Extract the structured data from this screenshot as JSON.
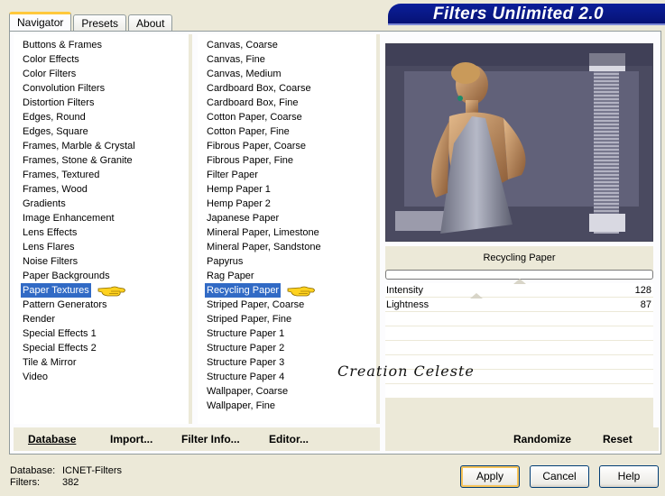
{
  "app": {
    "title": "Filters Unlimited 2.0"
  },
  "tabs": [
    {
      "label": "Navigator",
      "active": true
    },
    {
      "label": "Presets",
      "active": false
    },
    {
      "label": "About",
      "active": false
    }
  ],
  "categories": {
    "items": [
      "Buttons & Frames",
      "Color Effects",
      "Color Filters",
      "Convolution Filters",
      "Distortion Filters",
      "Edges, Round",
      "Edges, Square",
      "Frames, Marble & Crystal",
      "Frames, Stone & Granite",
      "Frames, Textured",
      "Frames, Wood",
      "Gradients",
      "Image Enhancement",
      "Lens Effects",
      "Lens Flares",
      "Noise Filters",
      "Paper Backgrounds",
      "Paper Textures",
      "Pattern Generators",
      "Render",
      "Special Effects 1",
      "Special Effects 2",
      "Tile & Mirror",
      "Video"
    ],
    "selected": "Paper Textures"
  },
  "filters": {
    "items": [
      "Canvas, Coarse",
      "Canvas, Fine",
      "Canvas, Medium",
      "Cardboard Box, Coarse",
      "Cardboard Box, Fine",
      "Cotton Paper, Coarse",
      "Cotton Paper, Fine",
      "Fibrous Paper, Coarse",
      "Fibrous Paper, Fine",
      "Filter Paper",
      "Hemp Paper 1",
      "Hemp Paper 2",
      "Japanese Paper",
      "Mineral Paper, Limestone",
      "Mineral Paper, Sandstone",
      "Papyrus",
      "Rag Paper",
      "Recycling Paper",
      "Striped Paper, Coarse",
      "Striped Paper, Fine",
      "Structure Paper 1",
      "Structure Paper 2",
      "Structure Paper 3",
      "Structure Paper 4",
      "Wallpaper, Coarse",
      "Wallpaper, Fine"
    ],
    "selected": "Recycling Paper"
  },
  "preview": {
    "filter_name": "Recycling Paper"
  },
  "parameters": [
    {
      "label": "Intensity",
      "value": "128",
      "level": 0.5
    },
    {
      "label": "Lightness",
      "value": "87",
      "level": 0.34
    }
  ],
  "toolbar": {
    "database": "Database",
    "import": "Import...",
    "filter_info": "Filter Info...",
    "editor": "Editor...",
    "randomize": "Randomize",
    "reset": "Reset"
  },
  "status": {
    "database_label": "Database:",
    "database_value": "ICNET-Filters",
    "filters_label": "Filters:",
    "filters_value": "382"
  },
  "buttons": {
    "apply": "Apply",
    "cancel": "Cancel",
    "help": "Help"
  },
  "watermark": "Creation Celeste",
  "colors": {
    "selection": "#316ac5",
    "title_bar": "#0b1f9a",
    "dialog": "#ece9d8"
  }
}
